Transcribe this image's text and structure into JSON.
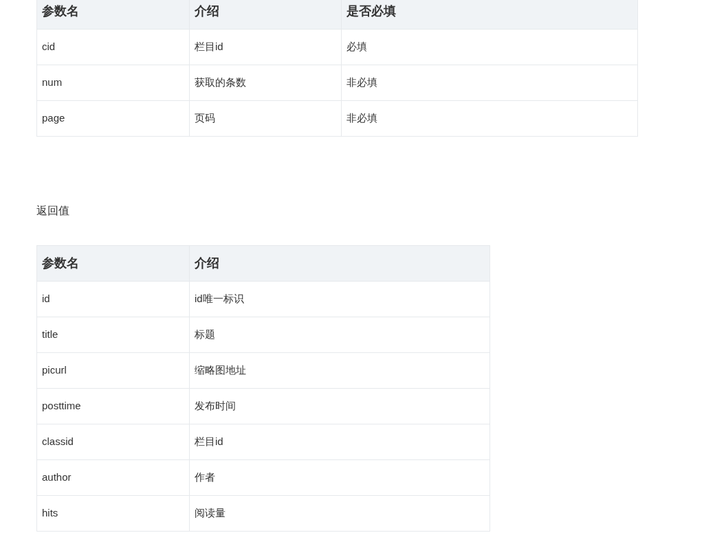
{
  "params_table": {
    "columns": [
      "参数名",
      "介绍",
      "是否必填"
    ],
    "rows": [
      [
        "cid",
        "栏目id",
        "必填"
      ],
      [
        "num",
        "获取的条数",
        "非必填"
      ],
      [
        "page",
        "页码",
        "非必填"
      ]
    ]
  },
  "return_label": "返回值",
  "return_table": {
    "columns": [
      "参数名",
      "介绍"
    ],
    "rows": [
      [
        "id",
        "id唯一标识"
      ],
      [
        "title",
        "标题"
      ],
      [
        "picurl",
        "缩略图地址"
      ],
      [
        "posttime",
        "发布时间"
      ],
      [
        "classid",
        "栏目id"
      ],
      [
        "author",
        "作者"
      ],
      [
        "hits",
        "阅读量"
      ]
    ]
  }
}
